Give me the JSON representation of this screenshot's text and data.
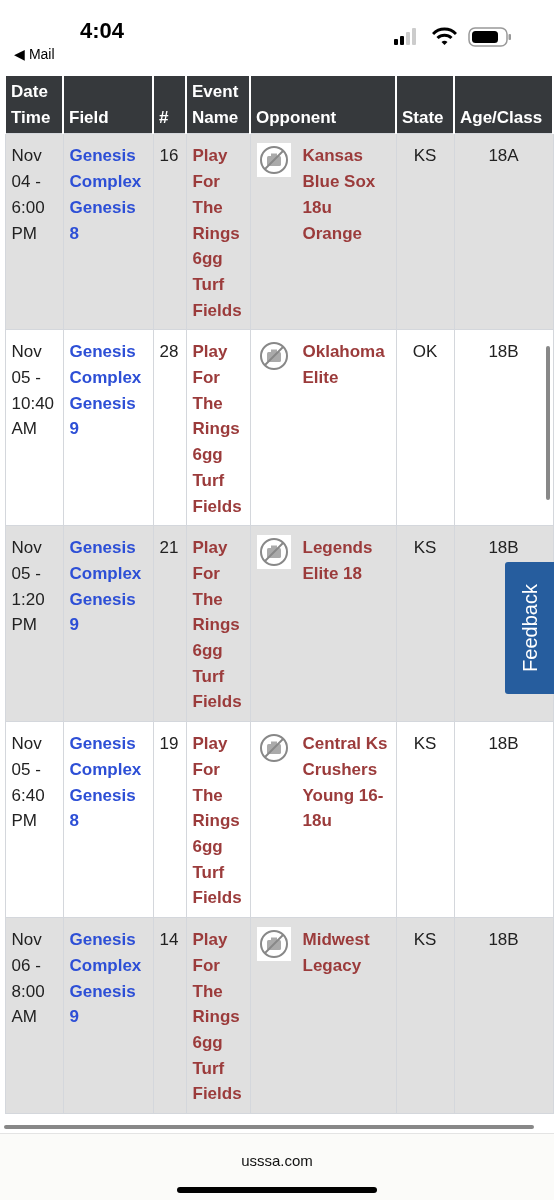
{
  "status_bar": {
    "time": "4:04",
    "back_label": "◀ Mail"
  },
  "table": {
    "columns": [
      {
        "lines": [
          "Date",
          "Time"
        ]
      },
      {
        "lines": [
          "Field"
        ]
      },
      {
        "lines": [
          "#"
        ]
      },
      {
        "lines": [
          "Event",
          "Name"
        ]
      },
      {
        "lines": [
          "Opponent"
        ]
      },
      {
        "lines": [
          "State"
        ]
      },
      {
        "lines": [
          "Age/Class"
        ]
      }
    ],
    "rows": [
      {
        "date": "Nov 04 - 6:00 PM",
        "field": "Genesis Complex Genesis 8",
        "number": "16",
        "event": "Play For The Rings 6gg Turf Fields",
        "opponent": "Kansas Blue Sox 18u Orange",
        "state": "KS",
        "age_class": "18A"
      },
      {
        "date": "Nov 05 - 10:40 AM",
        "field": "Genesis Complex Genesis 9",
        "number": "28",
        "event": "Play For The Rings 6gg Turf Fields",
        "opponent": "Oklahoma Elite",
        "state": "OK",
        "age_class": "18B"
      },
      {
        "date": "Nov 05 - 1:20 PM",
        "field": "Genesis Complex Genesis 9",
        "number": "21",
        "event": "Play For The Rings 6gg Turf Fields",
        "opponent": "Legends Elite 18",
        "state": "KS",
        "age_class": "18B"
      },
      {
        "date": "Nov 05 - 6:40 PM",
        "field": "Genesis Complex Genesis 8",
        "number": "19",
        "event": "Play For The Rings 6gg Turf Fields",
        "opponent": "Central Ks Crushers Young 16-18u",
        "state": "KS",
        "age_class": "18B"
      },
      {
        "date": "Nov 06 - 8:00 AM",
        "field": "Genesis Complex Genesis 9",
        "number": "14",
        "event": "Play For The Rings 6gg Turf Fields",
        "opponent": "Midwest Legacy",
        "state": "KS",
        "age_class": "18B"
      }
    ]
  },
  "feedback_tab": "Feedback",
  "address_bar": {
    "url": "usssa.com"
  }
}
